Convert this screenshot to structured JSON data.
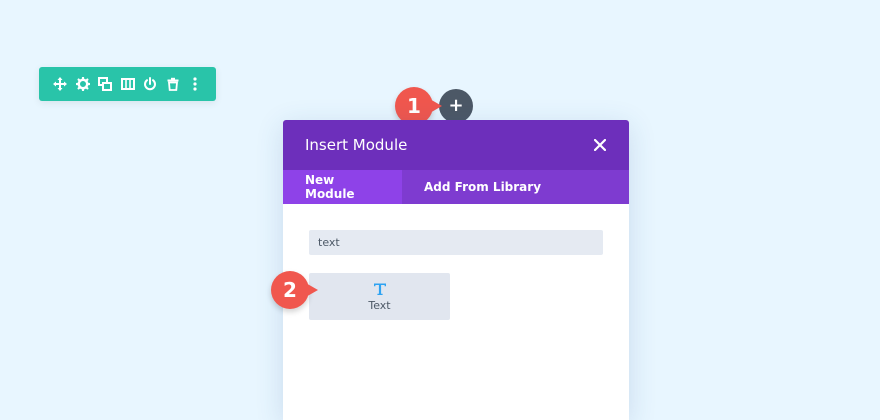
{
  "colors": {
    "background": "#e8f6ff",
    "toolbar": "#29c4a9",
    "add_button": "#4c5866",
    "callout": "#f0574e",
    "modal_header": "#6d2fbb",
    "tabs_bar": "#7e3bd0",
    "active_tab": "#8e42e8",
    "module_icon": "#2ea3f2"
  },
  "row_toolbar": {
    "icons": [
      "move-icon",
      "gear-icon",
      "duplicate-icon",
      "columns-icon",
      "power-icon",
      "trash-icon",
      "more-vertical-icon"
    ]
  },
  "add_module": {
    "icon": "plus-icon",
    "label": "+"
  },
  "callouts": [
    "1",
    "2"
  ],
  "modal": {
    "title": "Insert Module",
    "close_icon": "close-icon",
    "tabs": [
      {
        "label": "New Module",
        "active": true
      },
      {
        "label": "Add From Library",
        "active": false
      }
    ],
    "search": {
      "value": "text"
    },
    "modules": [
      {
        "label": "Text",
        "icon": "text-t-icon"
      }
    ]
  }
}
